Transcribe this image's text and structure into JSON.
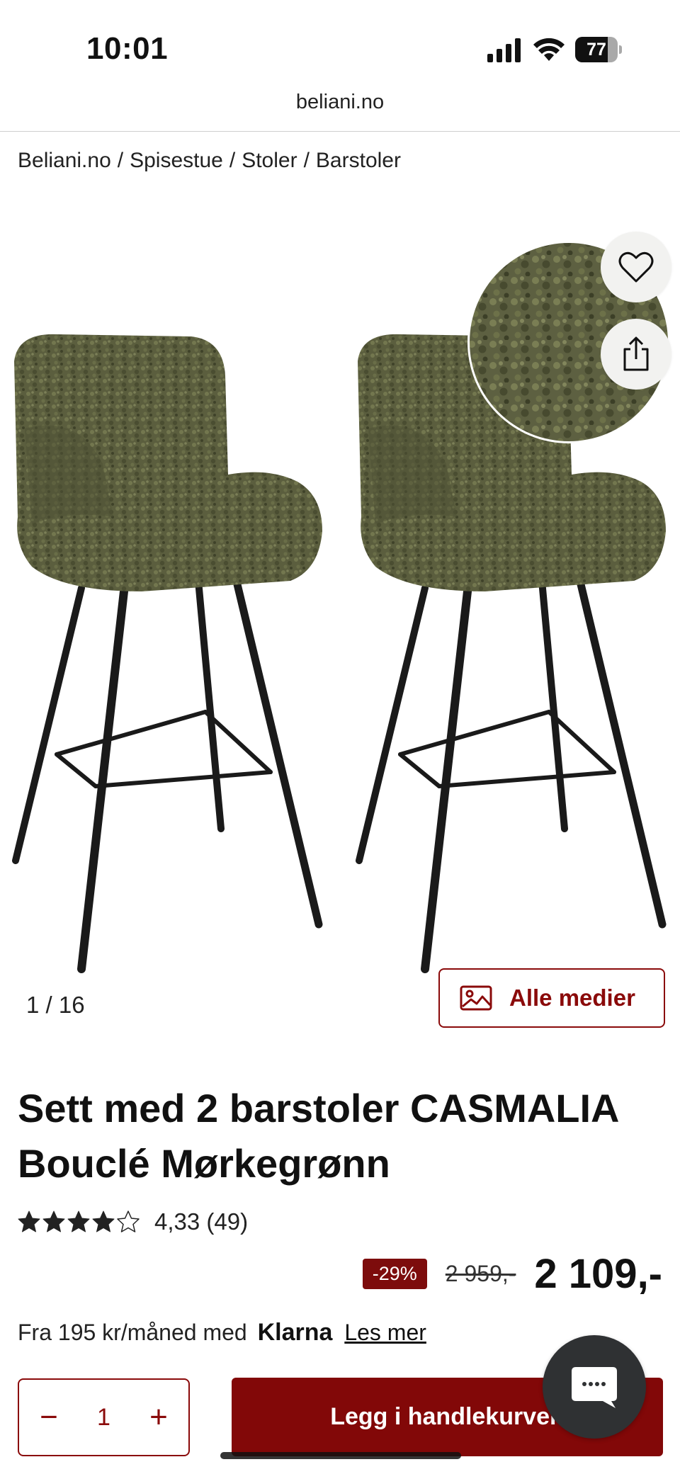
{
  "status_bar": {
    "time": "10:01",
    "battery": "77",
    "battery_level": 0.77
  },
  "browser": {
    "url": "beliani.no"
  },
  "breadcrumb": [
    "Beliani.no",
    "Spisestue",
    "Stoler",
    "Barstoler"
  ],
  "breadcrumb_separator": "/",
  "gallery": {
    "counter_current": "1 /",
    "counter_total": "16",
    "media_button_label": "Alle medier"
  },
  "product": {
    "title": "Sett med 2 barstoler CASMALIA Bouclé Mørkegrønn",
    "rating_value": 4.33,
    "rating_max": 5,
    "rating_text": "4,33 (49)",
    "discount": "-29%",
    "old_price": "2 959,-",
    "price": "2 109,-"
  },
  "financing": {
    "text": "Fra 195 kr/måned med",
    "provider": "Klarna",
    "link": "Les mer"
  },
  "cart": {
    "minus": "−",
    "quantity": "1",
    "plus": "+",
    "add_label": "Legg i handlekurven"
  },
  "colors": {
    "brand": "#820808",
    "text": "#111111",
    "fabric": "#5b5e3e",
    "legs": "#1a1a1a",
    "chat": "#2f3133"
  },
  "icons": {
    "favorite": "heart-icon",
    "share": "share-icon",
    "media": "image-icon",
    "chat": "chat-icon"
  }
}
